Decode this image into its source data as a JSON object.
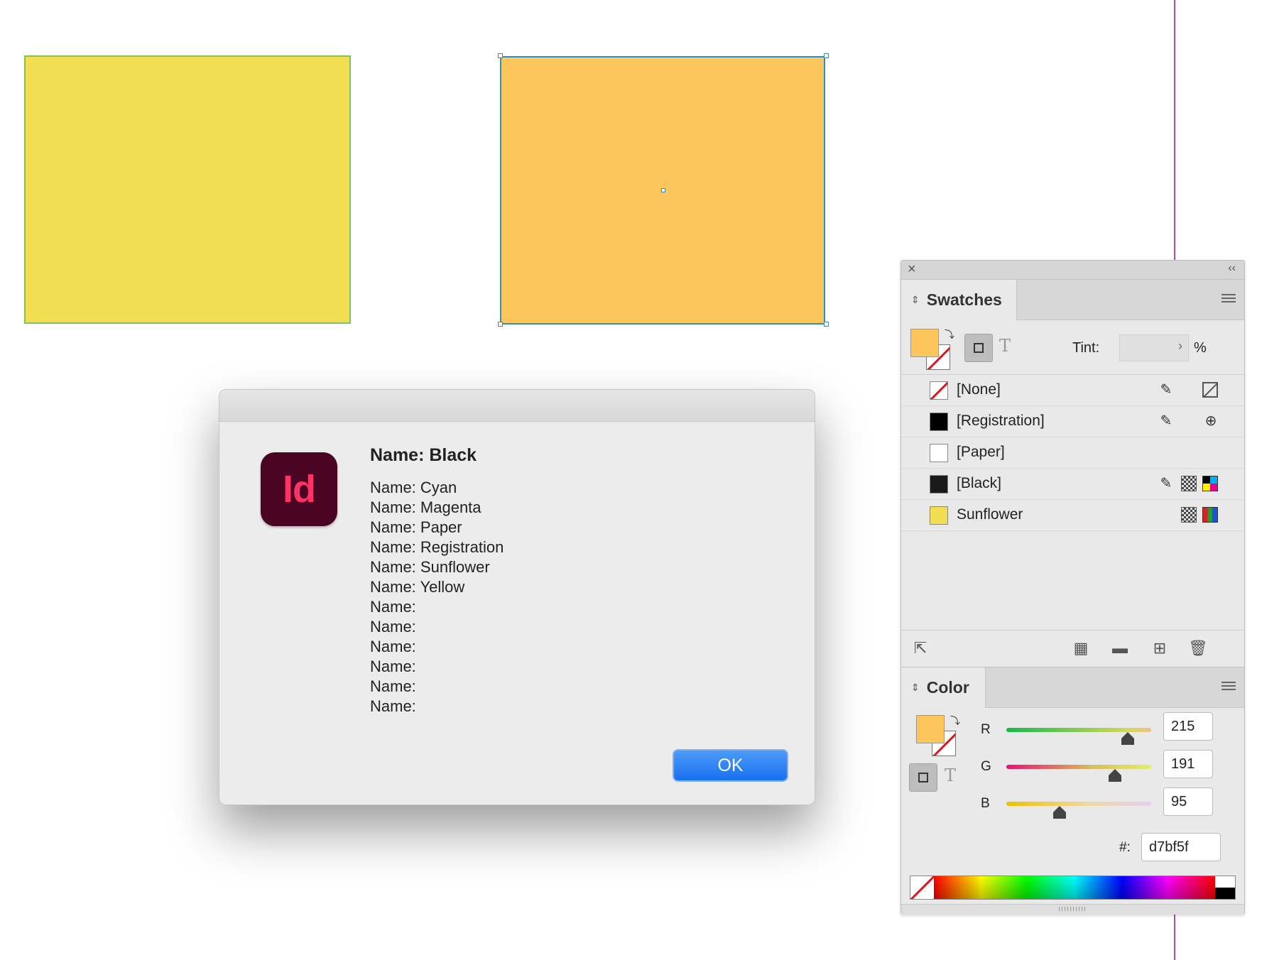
{
  "canvas": {
    "rect_yellow_color": "#f2de52",
    "rect_orange_color": "#fcc65c"
  },
  "dialog": {
    "app_icon_text": "Id",
    "title": "Name: Black",
    "lines": [
      "Name: Cyan",
      "Name: Magenta",
      "Name: Paper",
      "Name: Registration",
      "Name: Sunflower",
      "Name: Yellow",
      "Name:",
      "Name:",
      "Name:",
      "Name:",
      "Name:",
      "Name:"
    ],
    "ok_label": "OK"
  },
  "swatches_panel": {
    "close_icon": "×",
    "collapse_icon": "‹‹",
    "tab_label": "Swatches",
    "tint_label": "Tint:",
    "tint_value": "",
    "tint_unit": "%",
    "text_toggle": "T",
    "items": [
      {
        "label": "[None]",
        "chip": "none"
      },
      {
        "label": "[Registration]",
        "chip": "#000000"
      },
      {
        "label": "[Paper]",
        "chip": "#ffffff"
      },
      {
        "label": "[Black]",
        "chip": "#1a1a1a"
      },
      {
        "label": "Sunflower",
        "chip": "#f2de52"
      }
    ]
  },
  "color_panel": {
    "tab_label": "Color",
    "text_toggle": "T",
    "channels": [
      {
        "label": "R",
        "value": "215",
        "level": 0.84
      },
      {
        "label": "G",
        "value": "191",
        "level": 0.75
      },
      {
        "label": "B",
        "value": "95",
        "level": 0.37
      }
    ],
    "hex_label": "#:",
    "hex_value": "d7bf5f"
  }
}
